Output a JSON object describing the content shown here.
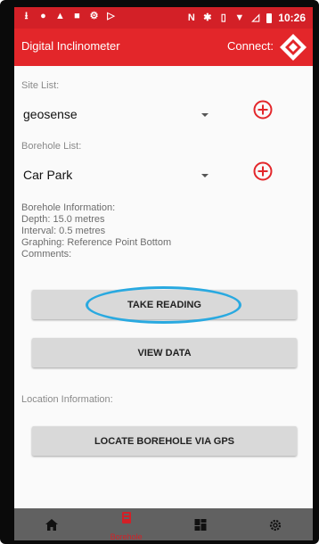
{
  "status_bar": {
    "time": "10:26",
    "left_icons": [
      "download-icon",
      "record-icon",
      "alert-icon",
      "image-icon",
      "settings-sync-icon",
      "play-store-icon"
    ],
    "right_icons": [
      "nfc-icon",
      "bluetooth-icon",
      "vibrate-icon",
      "wifi-icon",
      "no-signal-icon",
      "battery-icon"
    ]
  },
  "app_bar": {
    "title": "Digital Inclinometer",
    "connect_label": "Connect:"
  },
  "site_list": {
    "label": "Site List:",
    "value": "geosense"
  },
  "borehole_list": {
    "label": "Borehole List:",
    "value": "Car Park"
  },
  "borehole_info": {
    "heading": "Borehole Information:",
    "depth": "Depth: 15.0 metres",
    "interval": "Interval: 0.5 metres",
    "graphing": "Graphing: Reference Point Bottom",
    "comments": "Comments:"
  },
  "buttons": {
    "take_reading": "TAKE READING",
    "view_data": "VIEW DATA",
    "locate_gps": "LOCATE BOREHOLE VIA GPS"
  },
  "location": {
    "label": "Location Information:"
  },
  "bottom_nav": {
    "active_label": "Borehole",
    "items": [
      "home-icon",
      "borehole-icon",
      "dashboard-icon",
      "settings-icon"
    ]
  },
  "colors": {
    "brand": "#e3262a",
    "status_bar": "#d32027",
    "nav_bar": "#616161",
    "highlight": "#29a9e0"
  }
}
